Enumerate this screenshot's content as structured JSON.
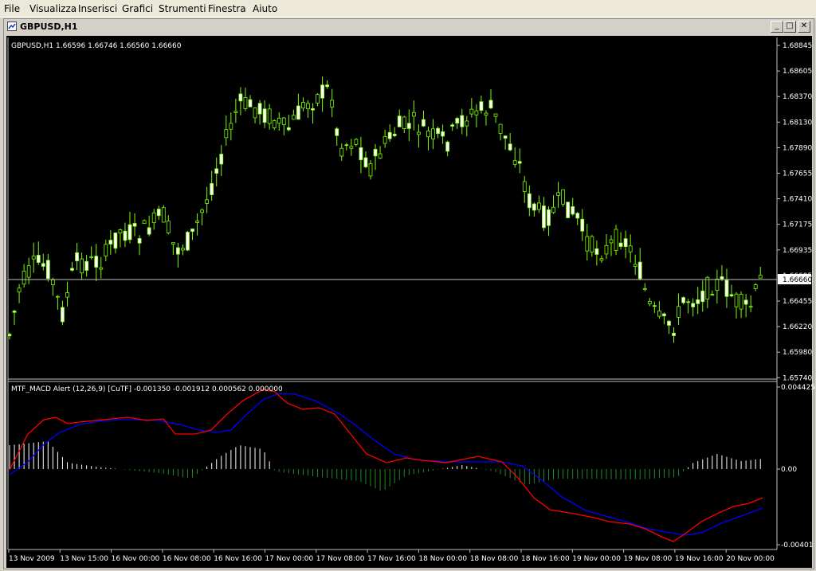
{
  "menu": [
    "File",
    "Visualizza",
    "Inserisci",
    "Grafici",
    "Strumenti",
    "Finestra",
    "Aiuto"
  ],
  "window": {
    "title": "GBPUSD,H1",
    "minimize": "_",
    "restore": "□",
    "close": "✕"
  },
  "main_chart": {
    "header": "GBPUSD,H1  1.66596 1.66746 1.66560 1.66660",
    "price_ticks": [
      "1.68845",
      "1.68605",
      "1.68370",
      "1.68130",
      "1.67890",
      "1.67655",
      "1.67410",
      "1.67175",
      "1.66935",
      "1.66695",
      "1.66455",
      "1.66220",
      "1.65980",
      "1.65740"
    ],
    "current_price": "1.66660",
    "colors": {
      "background": "#000000",
      "candle": "#7CFC00",
      "bull_body": "#000000",
      "bear_body": "#ffffff",
      "price_line": "#c0c0c0"
    }
  },
  "indicator": {
    "header": "MTF_MACD Alert (12,26,9) [CuTF] -0.001350 -0.001912 0.000562 0.000000",
    "ticks": [
      "0.004425",
      "0.00",
      "-0.00401"
    ],
    "colors": {
      "macd_line": "#ff0000",
      "signal_line": "#0000ff",
      "hist_pos": "#ffffff",
      "hist_neg": "#228b22"
    }
  },
  "time_axis": [
    "13 Nov 2009",
    "13 Nov 15:00",
    "16 Nov 00:00",
    "16 Nov 08:00",
    "16 Nov 16:00",
    "17 Nov 00:00",
    "17 Nov 08:00",
    "17 Nov 16:00",
    "18 Nov 00:00",
    "18 Nov 08:00",
    "18 Nov 16:00",
    "19 Nov 00:00",
    "19 Nov 08:00",
    "19 Nov 16:00",
    "20 Nov 00:00"
  ]
}
